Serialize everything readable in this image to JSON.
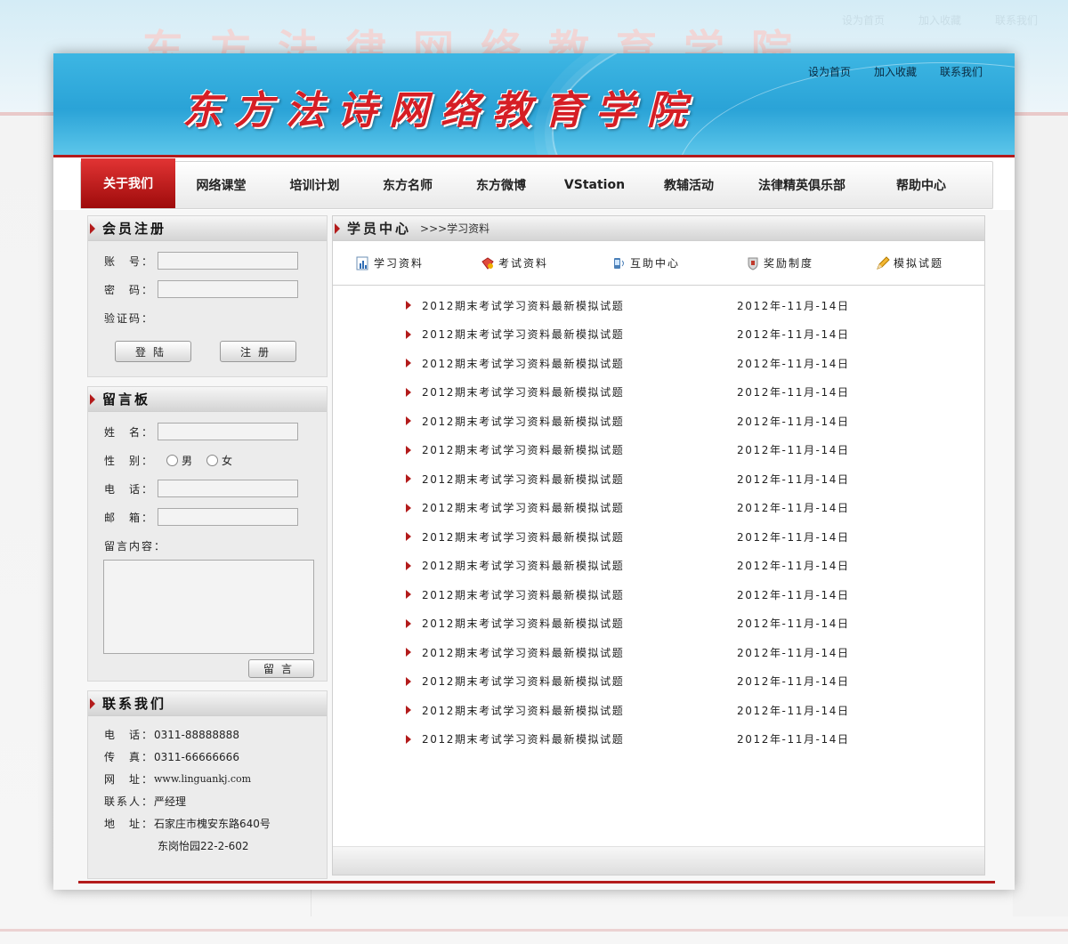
{
  "background": {
    "title": "东方法律网络教育学院",
    "top_links": [
      "设为首页",
      "加入收藏",
      "联系我们"
    ]
  },
  "header": {
    "title": "东方法诗网络教育学院",
    "top_links": [
      "设为首页",
      "加入收藏",
      "联系我们"
    ],
    "colors": {
      "banner": "#2aa3d7",
      "title": "#d61e25",
      "accent": "#b31b1b"
    }
  },
  "nav": {
    "items": [
      "关于我们",
      "网络课堂",
      "培训计划",
      "东方名师",
      "东方微博",
      "VStation",
      "教辅活动",
      "法律精英俱乐部",
      "帮助中心"
    ],
    "active": "关于我们"
  },
  "login": {
    "title": "会员注册",
    "account_label": "账　号：",
    "password_label": "密　码：",
    "captcha_label": "验证码：",
    "login_button": "登陆",
    "register_button": "注册"
  },
  "message": {
    "title": "留言板",
    "name_label": "姓　名：",
    "gender_label": "性　别：",
    "male": "男",
    "female": "女",
    "phone_label": "电　话：",
    "email_label": "邮　箱：",
    "content_label": "留言内容：",
    "submit_button": "留言"
  },
  "contact": {
    "title": "联系我们",
    "phone_k": "电　话：",
    "phone_v": "0311-88888888",
    "fax_k": "传　真：",
    "fax_v": "0311-66666666",
    "web_k": "网　址：",
    "web_v": "www.linguankj.com",
    "person_k": "联系人：",
    "person_v": "严经理",
    "addr_k": "地　址：",
    "addr_v1": "石家庄市槐安东路640号",
    "addr_v2": "东岗怡园22-2-602"
  },
  "main": {
    "title": "学员中心",
    "breadcrumb": ">>>学习资料",
    "tabs": [
      {
        "label": "学习资料",
        "icon": "chart-book-icon"
      },
      {
        "label": "考试资料",
        "icon": "gift-icon"
      },
      {
        "label": "互助中心",
        "icon": "phone-icon"
      },
      {
        "label": "奖励制度",
        "icon": "shield-icon"
      },
      {
        "label": "模拟试题",
        "icon": "pencil-icon"
      }
    ],
    "items": [
      {
        "title": "2012期末考试学习资料最新模拟试题",
        "date": "2012年-11月-14日"
      },
      {
        "title": "2012期末考试学习资料最新模拟试题",
        "date": "2012年-11月-14日"
      },
      {
        "title": "2012期末考试学习资料最新模拟试题",
        "date": "2012年-11月-14日"
      },
      {
        "title": "2012期末考试学习资料最新模拟试题",
        "date": "2012年-11月-14日"
      },
      {
        "title": "2012期末考试学习资料最新模拟试题",
        "date": "2012年-11月-14日"
      },
      {
        "title": "2012期末考试学习资料最新模拟试题",
        "date": "2012年-11月-14日"
      },
      {
        "title": "2012期末考试学习资料最新模拟试题",
        "date": "2012年-11月-14日"
      },
      {
        "title": "2012期末考试学习资料最新模拟试题",
        "date": "2012年-11月-14日"
      },
      {
        "title": "2012期末考试学习资料最新模拟试题",
        "date": "2012年-11月-14日"
      },
      {
        "title": "2012期末考试学习资料最新模拟试题",
        "date": "2012年-11月-14日"
      },
      {
        "title": "2012期末考试学习资料最新模拟试题",
        "date": "2012年-11月-14日"
      },
      {
        "title": "2012期末考试学习资料最新模拟试题",
        "date": "2012年-11月-14日"
      },
      {
        "title": "2012期末考试学习资料最新模拟试题",
        "date": "2012年-11月-14日"
      },
      {
        "title": "2012期末考试学习资料最新模拟试题",
        "date": "2012年-11月-14日"
      },
      {
        "title": "2012期末考试学习资料最新模拟试题",
        "date": "2012年-11月-14日"
      },
      {
        "title": "2012期末考试学习资料最新模拟试题",
        "date": "2012年-11月-14日"
      }
    ]
  }
}
